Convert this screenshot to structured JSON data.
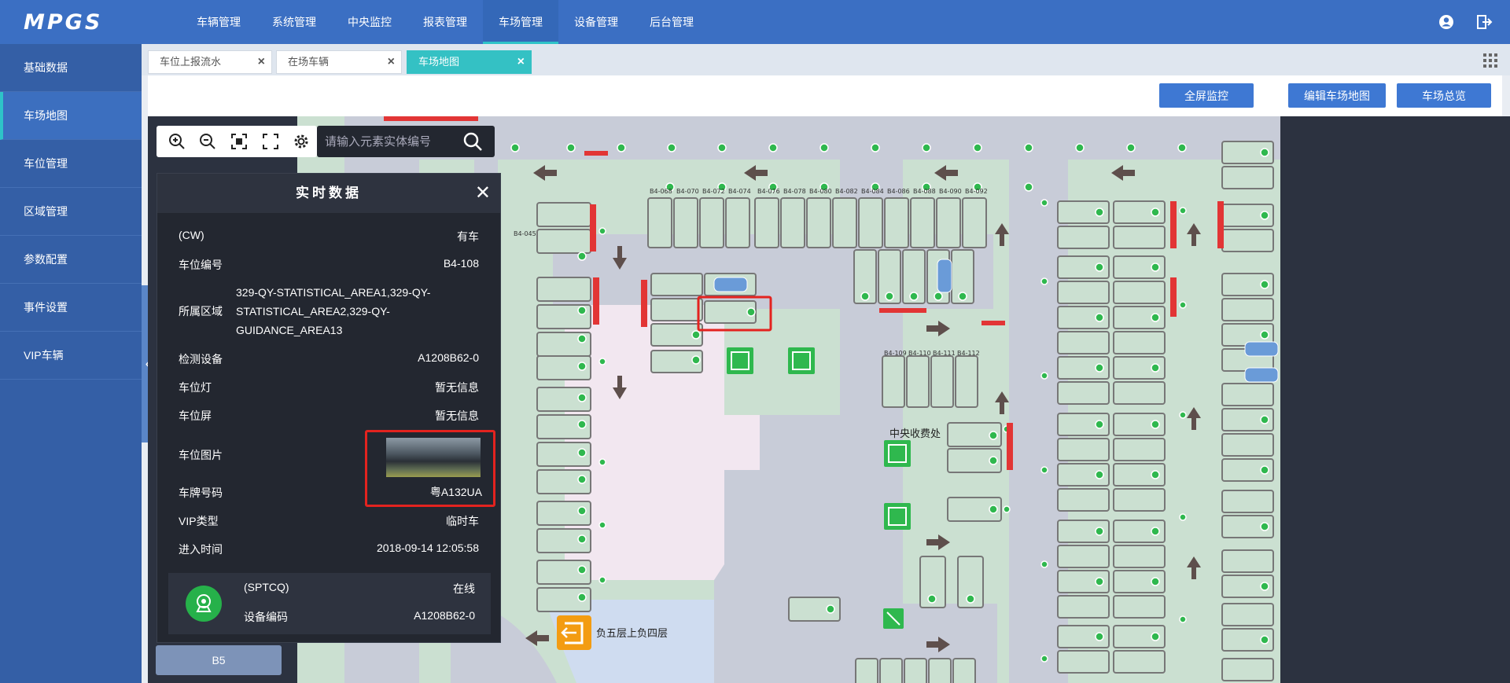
{
  "app": {
    "logo": "MPGS"
  },
  "topnav": [
    {
      "label": "车辆管理"
    },
    {
      "label": "系统管理"
    },
    {
      "label": "中央监控"
    },
    {
      "label": "报表管理"
    },
    {
      "label": "车场管理",
      "active": true
    },
    {
      "label": "设备管理"
    },
    {
      "label": "后台管理"
    }
  ],
  "sidebar": {
    "items": [
      {
        "label": "基础数据"
      },
      {
        "label": "车场地图",
        "active": true
      },
      {
        "label": "车位管理"
      },
      {
        "label": "区域管理"
      },
      {
        "label": "参数配置"
      },
      {
        "label": "事件设置"
      },
      {
        "label": "VIP车辆"
      }
    ],
    "toggle": "‹"
  },
  "tabs": [
    {
      "label": "车位上报流水"
    },
    {
      "label": "在场车辆"
    },
    {
      "label": "车场地图",
      "active": true
    }
  ],
  "toolbar": {
    "fullscreen": "全屏监控",
    "edit_map": "编辑车场地图",
    "overview": "车场总览"
  },
  "search": {
    "placeholder": "请输入元素实体编号"
  },
  "panel": {
    "title": "实时数据",
    "close": "✕",
    "cw_label": "(CW)",
    "cw_value": "有车",
    "space_no_label": "车位编号",
    "space_no": "B4-108",
    "area_label": "所属区域",
    "area_value": "329-QY-STATISTICAL_AREA1,329-QY-STATISTICAL_AREA2,329-QY-GUIDANCE_AREA13",
    "detector_label": "检测设备",
    "detector": "A1208B62-0",
    "light_label": "车位灯",
    "light": "暂无信息",
    "screen_label": "车位屏",
    "screen": "暂无信息",
    "photo_label": "车位图片",
    "plate_label": "车牌号码",
    "plate": "粤A132UA",
    "vip_label": "VIP类型",
    "vip": "临时车",
    "entry_label": "进入时间",
    "entry": "2018-09-14 12:05:58",
    "device": {
      "type_label": "(SPTCQ)",
      "status": "在线",
      "code_label": "设备编码",
      "code": "A1208B62-0"
    }
  },
  "map": {
    "central_label": "中央收费处",
    "exit_label": "负五层上负四层",
    "row_labels_top": [
      "B4-068",
      "B4-070",
      "B4-072",
      "B4-074",
      "B4-076",
      "B4-078",
      "B4-080",
      "B4-082",
      "B4-084",
      "B4-086",
      "B4-088",
      "B4-090",
      "B4-092"
    ],
    "row_labels_mid": [
      "B4-109",
      "B4-110",
      "B4-111",
      "B4-112"
    ]
  },
  "floor": {
    "label": "B5"
  },
  "colors": {
    "topbar": "#3b6fc3",
    "sidebar": "#345fa6",
    "accent": "#34c1c4",
    "highlight": "#e3231f"
  }
}
